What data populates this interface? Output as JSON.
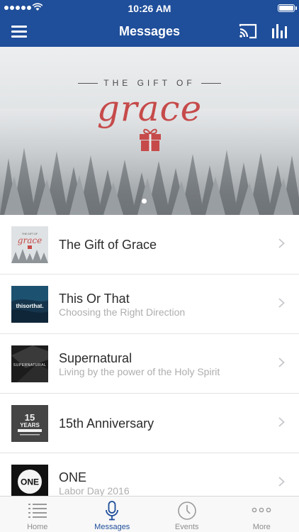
{
  "status_bar": {
    "time": "10:26 AM"
  },
  "header": {
    "title": "Messages",
    "menu_icon": "hamburger-icon",
    "cast_icon": "cast-icon",
    "stats_icon": "bar-chart-icon"
  },
  "hero": {
    "kicker": "THE GIFT OF",
    "title": "grace",
    "title_color": "#c64a4a",
    "slide_count": 1,
    "active_slide": 1
  },
  "messages": [
    {
      "title": "The Gift of Grace",
      "subtitle": ""
    },
    {
      "title": "This Or That",
      "subtitle": "Choosing the Right Direction"
    },
    {
      "title": "Supernatural",
      "subtitle": "Living by the power of the Holy Spirit"
    },
    {
      "title": "15th Anniversary",
      "subtitle": ""
    },
    {
      "title": "ONE",
      "subtitle": "Labor Day 2016"
    }
  ],
  "thumbnails": {
    "grace": {
      "kicker": "THE GIFT OF",
      "title": "grace"
    },
    "this_or_that": {
      "title": "thisorthat."
    },
    "supernatural": {
      "title": "SUPERNATURAL"
    },
    "anniversary": {
      "number": "15",
      "word": "YEARS"
    },
    "one": {
      "title": "ONE"
    }
  },
  "tab_bar": {
    "tabs": [
      {
        "label": "Home",
        "icon": "list-icon"
      },
      {
        "label": "Messages",
        "icon": "microphone-icon"
      },
      {
        "label": "Events",
        "icon": "clock-icon"
      },
      {
        "label": "More",
        "icon": "more-dots-icon"
      }
    ],
    "active": "Messages"
  },
  "colors": {
    "brand_blue": "#1f4e9a",
    "accent_red": "#c64a4a"
  }
}
